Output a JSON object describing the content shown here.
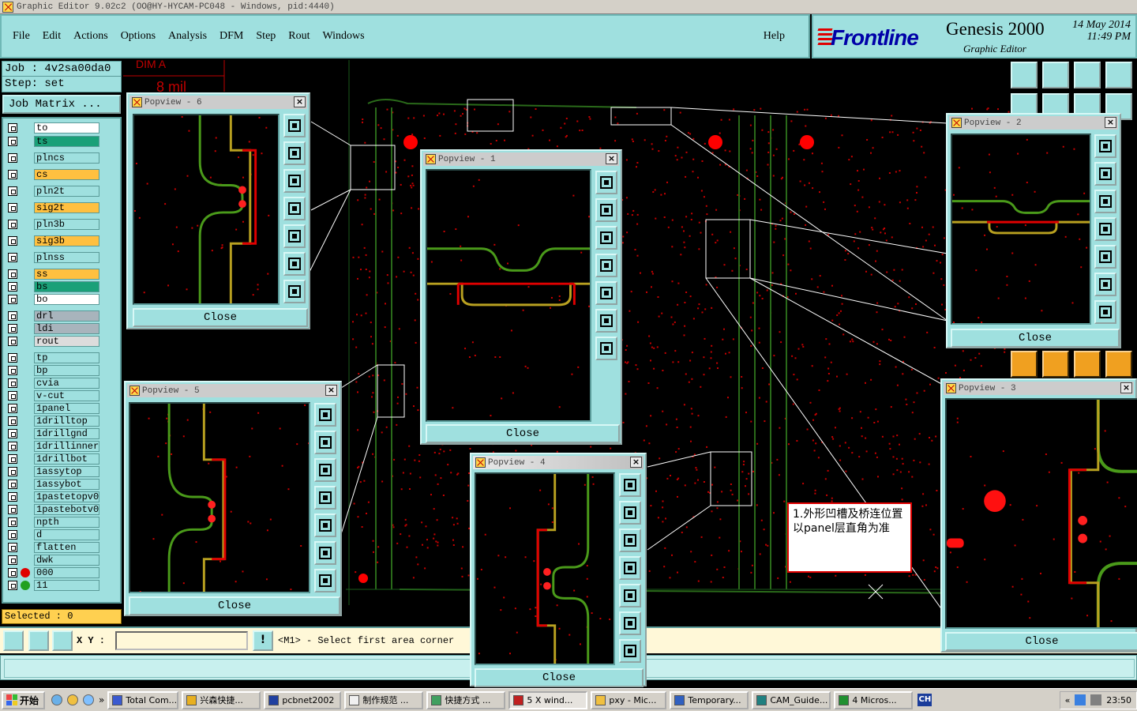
{
  "window": {
    "title": "Graphic Editor 9.02c2  (OO@HY-HYCAM-PC048 - Windows, pid:4440)"
  },
  "menu": {
    "items": [
      "File",
      "Edit",
      "Actions",
      "Options",
      "Analysis",
      "DFM",
      "Step",
      "Rout",
      "Windows"
    ],
    "help": "Help"
  },
  "brand": {
    "logo": "Frontline",
    "product": "Genesis 2000",
    "subtitle": "Graphic Editor",
    "date": "14 May 2014",
    "time": "11:49 PM"
  },
  "job": {
    "job_line": "Job : 4v2sa00da0",
    "step_line": "Step: set",
    "matrix_button": "Job Matrix ..."
  },
  "layers": [
    {
      "name": "to",
      "color": "#ffffff"
    },
    {
      "name": "ts",
      "color": "#1aa078"
    },
    {
      "name": "plncs",
      "color": "#9fe0df"
    },
    {
      "name": "cs",
      "color": "#ffc040"
    },
    {
      "name": "pln2t",
      "color": "#9fe0df"
    },
    {
      "name": "sig2t",
      "color": "#ffc040"
    },
    {
      "name": "pln3b",
      "color": "#9fe0df"
    },
    {
      "name": "sig3b",
      "color": "#ffc040"
    },
    {
      "name": "plnss",
      "color": "#9fe0df"
    },
    {
      "name": "ss",
      "color": "#ffc040"
    },
    {
      "name": "bs",
      "color": "#1aa078"
    },
    {
      "name": "bo",
      "color": "#ffffff"
    },
    {
      "name": "drl",
      "color": "#a8b4bc"
    },
    {
      "name": "ldi",
      "color": "#a8b4bc"
    },
    {
      "name": "rout",
      "color": "#dcdcdc"
    },
    {
      "name": "tp",
      "color": "#9fe0df"
    },
    {
      "name": "bp",
      "color": "#9fe0df"
    },
    {
      "name": "cvia",
      "color": "#9fe0df"
    },
    {
      "name": "v-cut",
      "color": "#9fe0df"
    },
    {
      "name": "1panel",
      "color": "#9fe0df"
    },
    {
      "name": "1drilltop",
      "color": "#9fe0df"
    },
    {
      "name": "1drillgnd",
      "color": "#9fe0df"
    },
    {
      "name": "1drillinner",
      "color": "#9fe0df"
    },
    {
      "name": "1drillbot",
      "color": "#9fe0df"
    },
    {
      "name": "1assytop",
      "color": "#9fe0df"
    },
    {
      "name": "1assybot",
      "color": "#9fe0df"
    },
    {
      "name": "1pastetopv0",
      "color": "#9fe0df"
    },
    {
      "name": "1pastebotv0",
      "color": "#9fe0df"
    },
    {
      "name": "npth",
      "color": "#9fe0df"
    },
    {
      "name": "d",
      "color": "#9fe0df"
    },
    {
      "name": "flatten",
      "color": "#9fe0df"
    },
    {
      "name": "dwk",
      "color": "#9fe0df"
    },
    {
      "name": "000",
      "color": "#9fe0df"
    },
    {
      "name": "11",
      "color": "#9fe0df"
    }
  ],
  "status": {
    "selected": "Selected : 0",
    "xy_label": "X Y :",
    "prompt": "<M1> - Select first area corner",
    "xy_value": ""
  },
  "board_labels": {
    "dim": "DIM  A",
    "mil": "8 mil"
  },
  "note": {
    "text": "1.外形凹槽及桥连位置以panel层直角为准"
  },
  "popviews": [
    {
      "id": 6,
      "title": "Popview - 6",
      "close": "Close"
    },
    {
      "id": 1,
      "title": "Popview - 1",
      "close": "Close"
    },
    {
      "id": 2,
      "title": "Popview - 2",
      "close": "Close"
    },
    {
      "id": 5,
      "title": "Popview - 5",
      "close": "Close"
    },
    {
      "id": 4,
      "title": "Popview - 4",
      "close": "Close"
    },
    {
      "id": 3,
      "title": "Popview - 3",
      "close": "Close"
    }
  ],
  "taskbar": {
    "start": "开始",
    "tasks": [
      "Total Com...",
      "兴森快捷...",
      "pcbnet2002",
      "制作规范 ...",
      "快捷方式 ...",
      "5 X wind...",
      "pxy - Mic...",
      "Temporary...",
      "CAM_Guide...",
      "4 Micros..."
    ],
    "lang": "CH",
    "clock": "23:50"
  },
  "colors": {
    "panel": "#9fe0df",
    "status_yellow": "#ffd050",
    "copper_red": "#e00000",
    "outline_green": "#4a9a1a",
    "outline_gold": "#b8a020"
  }
}
